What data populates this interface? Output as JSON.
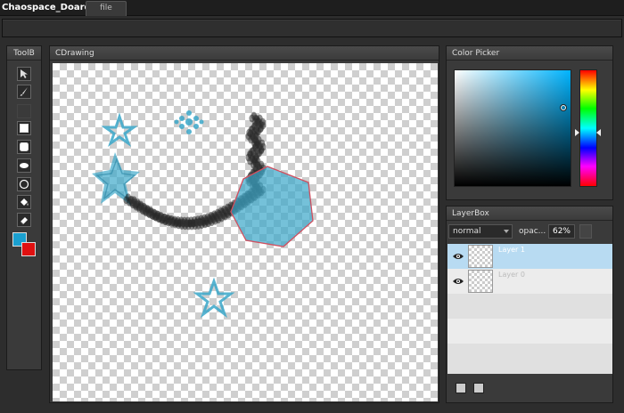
{
  "app": {
    "title": "Chaospace_Doard"
  },
  "menu": {
    "file_label": "file"
  },
  "tools": {
    "header": "ToolB",
    "items": [
      "select-arrow-icon",
      "brush-icon",
      "empty-slot-icon",
      "square-outline-icon",
      "rounded-square-icon",
      "ellipse-icon",
      "circle-outline-icon",
      "fill-bucket-icon",
      "eraser-icon"
    ],
    "primary_color": "#1aa0d0",
    "secondary_color": "#e01010"
  },
  "drawing": {
    "header": "CDrawing",
    "accent": "#3aa7c9",
    "stroke_dark": "#1a1a1a",
    "polygon_edge": "#d05060"
  },
  "color_picker": {
    "header": "Color Picker",
    "hue": "#00b4ff"
  },
  "layers": {
    "header": "LayerBox",
    "blend_mode": "normal",
    "opacity_label": "opac...",
    "opacity_value": "62%",
    "items": [
      {
        "name": "Layer 1",
        "selected": true
      },
      {
        "name": "Layer 0",
        "selected": false
      }
    ]
  }
}
